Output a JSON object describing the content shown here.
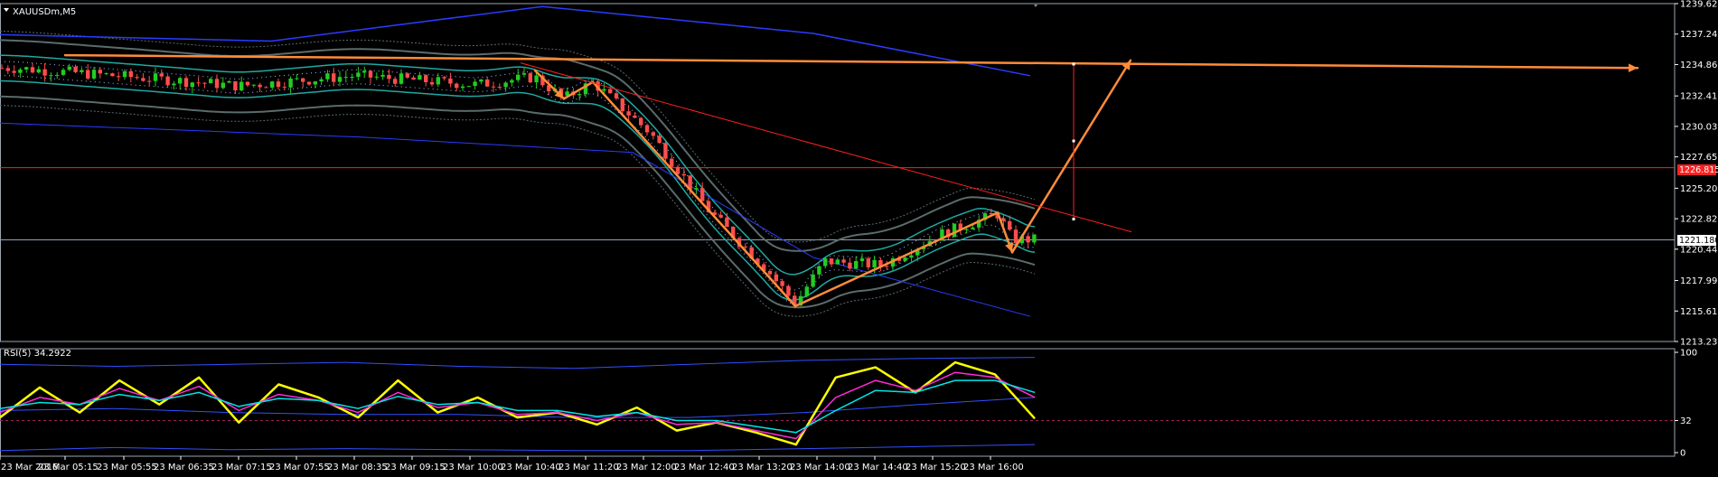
{
  "chart_data": [
    {
      "type": "candlestick",
      "title": "XAUUSDm,M5",
      "title_icon": "triangle-down-icon",
      "y_ticks": [
        "1239.628",
        "1237.248",
        "1234.868",
        "1232.418",
        "1230.038",
        "1227.658",
        "1225.208",
        "1222.828",
        "1220.448",
        "1217.998",
        "1215.618",
        "1213.238"
      ],
      "ylim": [
        1213.238,
        1239.628
      ],
      "x_ticks": [
        "23 Mar 2016",
        "23 Mar 05:15",
        "23 Mar 05:55",
        "23 Mar 06:35",
        "23 Mar 07:15",
        "23 Mar 07:55",
        "23 Mar 08:35",
        "23 Mar 09:15",
        "23 Mar 10:00",
        "23 Mar 10:40",
        "23 Mar 11:20",
        "23 Mar 12:00",
        "23 Mar 12:40",
        "23 Mar 13:20",
        "23 Mar 14:00",
        "23 Mar 14:40",
        "23 Mar 15:20",
        "23 Mar 16:00"
      ],
      "price_tags": {
        "red_line": "1226.815",
        "bid_line": "1221.180"
      },
      "colors": {
        "background": "#000000",
        "bull": "#22cc22",
        "bear": "#ff4d4d",
        "red_line": "#ff2020",
        "bid_line": "#8fa3b5",
        "annotation": "#ff8c3a",
        "ma_blue": "#2a3cff",
        "band_teal": "#20a8a0",
        "band_grey": "#5b6b6b"
      },
      "key_points": [
        {
          "x": "23 Mar 04:40",
          "y": 1234.6
        },
        {
          "x": "23 Mar 06:35",
          "y": 1233.6
        },
        {
          "x": "23 Mar 07:15",
          "y": 1233.2
        },
        {
          "x": "23 Mar 08:35",
          "y": 1234.0
        },
        {
          "x": "23 Mar 10:00",
          "y": 1233.3
        },
        {
          "x": "23 Mar 10:40",
          "y": 1233.9
        },
        {
          "x": "23 Mar 11:00",
          "y": 1232.2
        },
        {
          "x": "23 Mar 11:20",
          "y": 1233.5
        },
        {
          "x": "23 Mar 12:00",
          "y": 1229.5
        },
        {
          "x": "23 Mar 12:40",
          "y": 1223.5
        },
        {
          "x": "23 Mar 13:20",
          "y": 1218.9
        },
        {
          "x": "23 Mar 13:40",
          "y": 1216.2
        },
        {
          "x": "23 Mar 14:00",
          "y": 1219.5
        },
        {
          "x": "23 Mar 14:40",
          "y": 1219.2
        },
        {
          "x": "23 Mar 15:20",
          "y": 1221.6
        },
        {
          "x": "23 Mar 16:00",
          "y": 1223.2
        },
        {
          "x": "23 Mar 16:10",
          "y": 1221.2
        }
      ]
    },
    {
      "type": "line",
      "title": "RSI(5) 34.2922",
      "y_ticks": [
        "100",
        "32",
        "0"
      ],
      "ylim": [
        0,
        100
      ],
      "level": 32,
      "series": [
        {
          "color": "#ffff00",
          "values": [
            35,
            65,
            40,
            72,
            48,
            75,
            30,
            68,
            55,
            35,
            72,
            40,
            55,
            35,
            40,
            28,
            45,
            22,
            30,
            20,
            8,
            75,
            85,
            60,
            90,
            78,
            34
          ]
        },
        {
          "color": "#ff2bd6",
          "values": [
            40,
            55,
            48,
            64,
            52,
            66,
            42,
            58,
            52,
            40,
            60,
            45,
            50,
            38,
            40,
            32,
            40,
            28,
            30,
            22,
            14,
            55,
            72,
            62,
            80,
            75,
            55
          ]
        },
        {
          "color": "#00e5e5",
          "values": [
            44,
            50,
            48,
            58,
            52,
            60,
            46,
            54,
            52,
            44,
            56,
            48,
            50,
            42,
            42,
            36,
            40,
            32,
            32,
            26,
            20,
            42,
            62,
            60,
            72,
            72,
            60
          ]
        }
      ]
    }
  ]
}
